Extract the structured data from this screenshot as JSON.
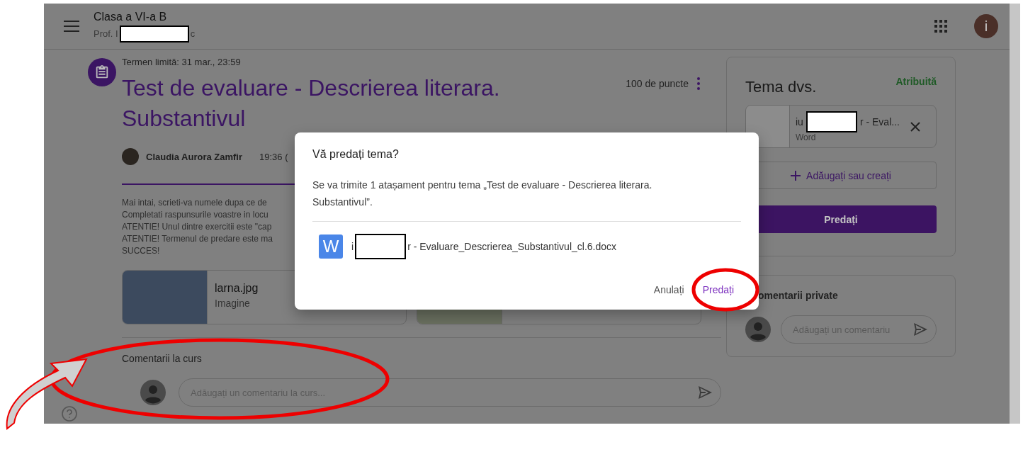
{
  "header": {
    "title": "Clasa a VI-a B",
    "subtitle_start": "Prof. I",
    "subtitle_end": "c",
    "avatar_letter": "i"
  },
  "assignment": {
    "due": "Termen limită: 31 mar., 23:59",
    "title": "Test de evaluare - Descrierea literara. Substantivul",
    "points": "100 de puncte",
    "author": "Claudia Aurora Zamfir",
    "posted": "19:36 (",
    "description": [
      "Mai intai, scrieti-va numele dupa ce de",
      "Completati raspunsurile voastre in locu",
      "ATENTIE! Unul dintre exercitii este \"cap",
      "ATENTIE! Termenul de predare este ma",
      "SUCCES!"
    ],
    "attachments": [
      {
        "name": "larna.jpg",
        "type": "Imagine"
      }
    ]
  },
  "class_comments": {
    "title": "Comentarii la curs",
    "placeholder": "Adăugați un comentariu la curs..."
  },
  "your_work": {
    "title": "Tema dvs.",
    "status": "Atribuită",
    "file": {
      "name_start": "iu",
      "name_end": "r - Eval...",
      "type": "Word"
    },
    "add_button": "Adăugați sau creați",
    "submit_button": "Predați"
  },
  "private_comments": {
    "title": "omentarii private",
    "placeholder": "Adăugați un comentariu"
  },
  "dialog": {
    "title": "Vă predați tema?",
    "message": "Se va trimite 1 atașament pentru tema „Test de evaluare - Descrierea literara. Substantivul”.",
    "file": {
      "icon_letter": "W",
      "name_start": "i",
      "name_end": "r - Evaluare_Descrierea_Substantivul_cl.6.docx"
    },
    "buttons": [
      {
        "label": "Anulați",
        "kind": "text"
      },
      {
        "label": "Predați",
        "kind": "primary"
      }
    ]
  }
}
